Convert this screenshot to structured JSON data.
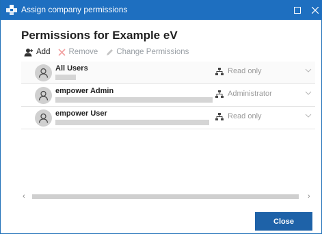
{
  "window": {
    "title": "Assign company permissions",
    "controls": {
      "maximize": "maximize-icon",
      "close": "close-icon"
    }
  },
  "heading": "Permissions for Example eV",
  "toolbar": {
    "add_label": "Add",
    "remove_label": "Remove",
    "change_label": "Change Permissions"
  },
  "users": [
    {
      "name": "All Users",
      "role": "Read only",
      "selected": true
    },
    {
      "name": "empower Admin",
      "role": "Administrator",
      "selected": false
    },
    {
      "name": "empower User",
      "role": "Read only",
      "selected": false
    }
  ],
  "footer": {
    "close_label": "Close"
  },
  "colors": {
    "titlebar": "#1e6fc0",
    "primary_button": "#1e62a8",
    "remove_icon": "#f2a0a0"
  }
}
